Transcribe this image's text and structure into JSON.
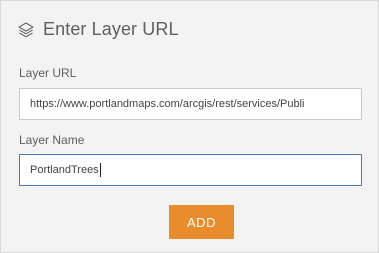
{
  "dialog": {
    "title": "Enter Layer URL",
    "header_icon": "layers-icon"
  },
  "layer_url": {
    "label": "Layer URL",
    "value": "https://www.portlandmaps.com/arcgis/rest/services/Publi"
  },
  "layer_name": {
    "label": "Layer Name",
    "value": "PortlandTrees"
  },
  "actions": {
    "add_label": "ADD"
  },
  "colors": {
    "accent": "#e88c2c",
    "focus_border": "#4a7dbd",
    "panel_bg": "#f3f3f3"
  }
}
